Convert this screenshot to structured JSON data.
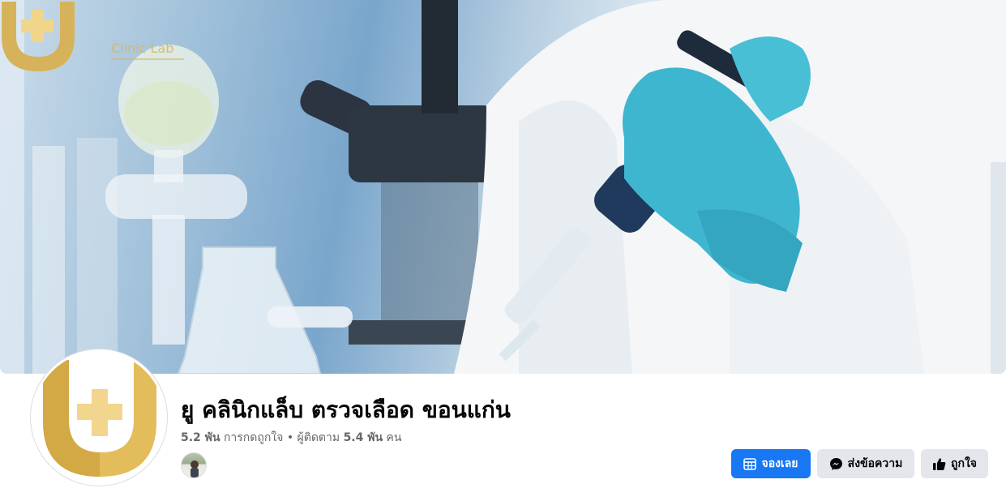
{
  "cover": {
    "logo_text": "Clinic Lab",
    "icons": [
      "clinic-logo-icon"
    ],
    "colors": {
      "logo_gold": "#d8b55c",
      "glove_blue": "#3fb6cf"
    }
  },
  "page": {
    "title": "ยู คลินิกแล็บ ตรวจเลือด ขอนแก่น",
    "likes_count": "5.2 พัน",
    "likes_label": "การกดถูกใจ",
    "separator": "•",
    "followers_label": "ผู้ติดตาม",
    "followers_count": "5.4 พัน",
    "followers_unit": "คน"
  },
  "actions": {
    "book_label": "จองเลย",
    "message_label": "ส่งข้อความ",
    "like_label": "ถูกใจ",
    "icons": [
      "calendar-icon",
      "messenger-icon",
      "thumbs-up-icon"
    ],
    "colors": {
      "primary": "#1877f2",
      "secondary_bg": "#e4e6eb"
    }
  }
}
